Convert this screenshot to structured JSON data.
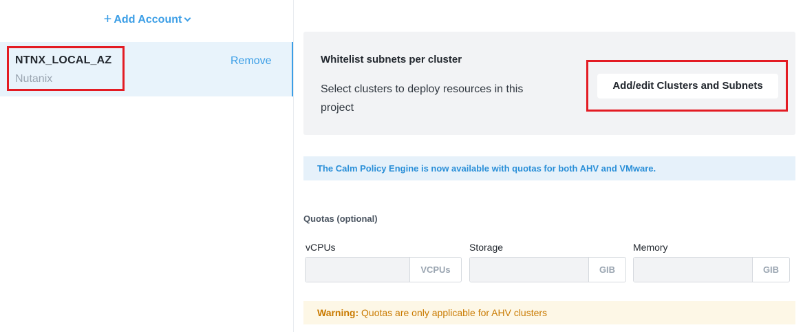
{
  "sidebar": {
    "add_account_plus": "+",
    "add_account_label": "Add Account",
    "account": {
      "name": "NTNX_LOCAL_AZ",
      "type": "Nutanix",
      "remove_label": "Remove"
    }
  },
  "whitelist": {
    "title": "Whitelist subnets per cluster",
    "description": "Select clusters to deploy resources in this project",
    "button_label": "Add/edit Clusters and Subnets"
  },
  "info_banner": "The Calm Policy Engine is now available with quotas for both AHV and VMware.",
  "quotas": {
    "title": "Quotas (optional)",
    "fields": [
      {
        "label": "vCPUs",
        "value": "",
        "unit": "VCPUs"
      },
      {
        "label": "Storage",
        "value": "",
        "unit": "GIB"
      },
      {
        "label": "Memory",
        "value": "",
        "unit": "GIB"
      }
    ]
  },
  "warning": {
    "prefix": "Warning:",
    "text": " Quotas are only applicable for AHV clusters"
  },
  "colors": {
    "accent": "#3b9ee6",
    "highlight_box": "#e31b23",
    "warning_text": "#c97a00",
    "info_text": "#2a8fd8"
  }
}
